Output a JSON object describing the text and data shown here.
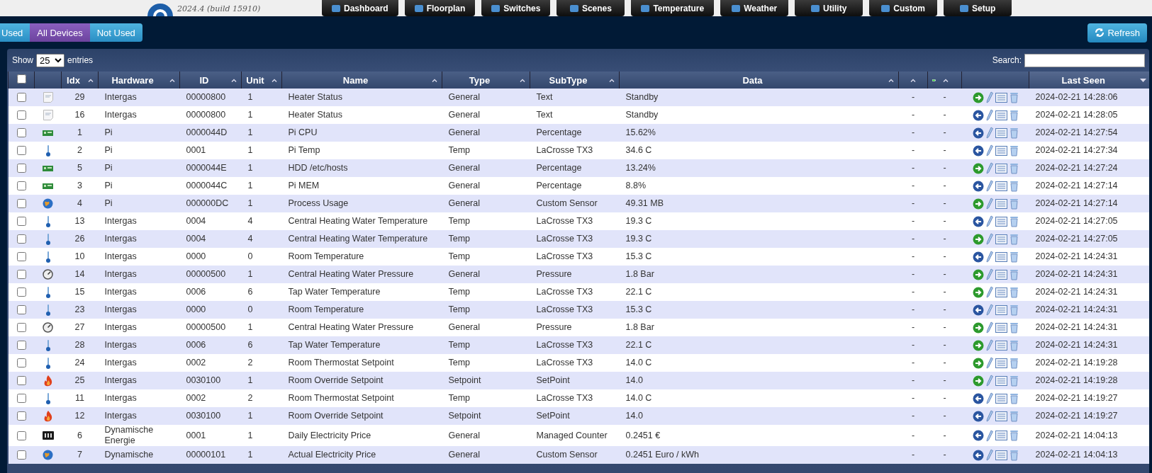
{
  "header": {
    "version": "2024.4 (build 15910)",
    "nav": [
      "Dashboard",
      "Floorplan",
      "Switches",
      "Scenes",
      "Temperature",
      "Weather",
      "Utility",
      "Custom",
      "Setup"
    ]
  },
  "filters": [
    {
      "label": "Used",
      "selected": false
    },
    {
      "label": "All Devices",
      "selected": true
    },
    {
      "label": "Not Used",
      "selected": false
    }
  ],
  "refresh_button": "Refresh",
  "table": {
    "show_label": "Show",
    "page_size": "25",
    "entries_label": "entries",
    "search_label": "Search:",
    "select_all_checked": false,
    "columns": [
      {
        "kind": "icon"
      },
      {
        "kind": "text",
        "label": "Idx",
        "sorted": false
      },
      {
        "kind": "text",
        "label": "Hardware",
        "sorted": false
      },
      {
        "kind": "text",
        "label": "ID",
        "sorted": false
      },
      {
        "kind": "text",
        "label": "Unit",
        "sorted": false
      },
      {
        "kind": "text",
        "label": "Name",
        "sorted": false
      },
      {
        "kind": "text",
        "label": "Type",
        "sorted": false
      },
      {
        "kind": "text",
        "label": "SubType",
        "sorted": false
      },
      {
        "kind": "text",
        "label": "Data",
        "sorted": false
      },
      {
        "kind": "signal",
        "sorted": false
      },
      {
        "kind": "battery",
        "sorted": false
      },
      {
        "kind": "actions"
      },
      {
        "kind": "text",
        "label": "Last Seen",
        "sorted": true
      }
    ],
    "rows": [
      {
        "checked": false,
        "kind": "text",
        "idx": "29",
        "hardware": "Intergas",
        "id": "00000800",
        "unit": "1",
        "name": "Heater Status",
        "type": "General",
        "subtype": "Text",
        "data": "Standby",
        "signal": "-",
        "battery": "-",
        "used": false,
        "last_seen": "2024-02-21 14:28:06"
      },
      {
        "checked": false,
        "kind": "text",
        "idx": "16",
        "hardware": "Intergas",
        "id": "00000800",
        "unit": "1",
        "name": "Heater Status",
        "type": "General",
        "subtype": "Text",
        "data": "Standby",
        "signal": "-",
        "battery": "-",
        "used": true,
        "last_seen": "2024-02-21 14:28:05"
      },
      {
        "checked": false,
        "kind": "board",
        "idx": "1",
        "hardware": "Pi",
        "id": "0000044D",
        "unit": "1",
        "name": "Pi CPU",
        "type": "General",
        "subtype": "Percentage",
        "data": "15.62%",
        "signal": "-",
        "battery": "-",
        "used": true,
        "last_seen": "2024-02-21 14:27:54"
      },
      {
        "checked": false,
        "kind": "thermometer",
        "idx": "2",
        "hardware": "Pi",
        "id": "0001",
        "unit": "1",
        "name": "Pi Temp",
        "type": "Temp",
        "subtype": "LaCrosse TX3",
        "data": "34.6 C",
        "signal": "-",
        "battery": "-",
        "used": true,
        "last_seen": "2024-02-21 14:27:34"
      },
      {
        "checked": false,
        "kind": "board",
        "idx": "5",
        "hardware": "Pi",
        "id": "0000044E",
        "unit": "1",
        "name": "HDD /etc/hosts",
        "type": "General",
        "subtype": "Percentage",
        "data": "13.24%",
        "signal": "-",
        "battery": "-",
        "used": false,
        "last_seen": "2024-02-21 14:27:24"
      },
      {
        "checked": false,
        "kind": "board",
        "idx": "3",
        "hardware": "Pi",
        "id": "0000044C",
        "unit": "1",
        "name": "Pi MEM",
        "type": "General",
        "subtype": "Percentage",
        "data": "8.8%",
        "signal": "-",
        "battery": "-",
        "used": true,
        "last_seen": "2024-02-21 14:27:14"
      },
      {
        "checked": false,
        "kind": "globe",
        "idx": "4",
        "hardware": "Pi",
        "id": "000000DC",
        "unit": "1",
        "name": "Process Usage",
        "type": "General",
        "subtype": "Custom Sensor",
        "data": "49.31 MB",
        "signal": "-",
        "battery": "-",
        "used": false,
        "last_seen": "2024-02-21 14:27:14"
      },
      {
        "checked": false,
        "kind": "thermometer",
        "idx": "13",
        "hardware": "Intergas",
        "id": "0004",
        "unit": "4",
        "name": "Central Heating Water Temperature",
        "type": "Temp",
        "subtype": "LaCrosse TX3",
        "data": "19.3 C",
        "signal": "-",
        "battery": "-",
        "used": true,
        "last_seen": "2024-02-21 14:27:05"
      },
      {
        "checked": false,
        "kind": "thermometer",
        "idx": "26",
        "hardware": "Intergas",
        "id": "0004",
        "unit": "4",
        "name": "Central Heating Water Temperature",
        "type": "Temp",
        "subtype": "LaCrosse TX3",
        "data": "19.3 C",
        "signal": "-",
        "battery": "-",
        "used": false,
        "last_seen": "2024-02-21 14:27:05"
      },
      {
        "checked": false,
        "kind": "thermometer",
        "idx": "10",
        "hardware": "Intergas",
        "id": "0000",
        "unit": "0",
        "name": "Room Temperature",
        "type": "Temp",
        "subtype": "LaCrosse TX3",
        "data": "15.3 C",
        "signal": "-",
        "battery": "-",
        "used": true,
        "last_seen": "2024-02-21 14:24:31"
      },
      {
        "checked": false,
        "kind": "gauge",
        "idx": "14",
        "hardware": "Intergas",
        "id": "00000500",
        "unit": "1",
        "name": "Central Heating Water Pressure",
        "type": "General",
        "subtype": "Pressure",
        "data": "1.8 Bar",
        "signal": "-",
        "battery": "-",
        "used": false,
        "last_seen": "2024-02-21 14:24:31"
      },
      {
        "checked": false,
        "kind": "thermometer",
        "idx": "15",
        "hardware": "Intergas",
        "id": "0006",
        "unit": "6",
        "name": "Tap Water Temperature",
        "type": "Temp",
        "subtype": "LaCrosse TX3",
        "data": "22.1 C",
        "signal": "-",
        "battery": "-",
        "used": false,
        "last_seen": "2024-02-21 14:24:31"
      },
      {
        "checked": false,
        "kind": "thermometer",
        "idx": "23",
        "hardware": "Intergas",
        "id": "0000",
        "unit": "0",
        "name": "Room Temperature",
        "type": "Temp",
        "subtype": "LaCrosse TX3",
        "data": "15.3 C",
        "signal": "-",
        "battery": "-",
        "used": true,
        "last_seen": "2024-02-21 14:24:31"
      },
      {
        "checked": false,
        "kind": "gauge",
        "idx": "27",
        "hardware": "Intergas",
        "id": "00000500",
        "unit": "1",
        "name": "Central Heating Water Pressure",
        "type": "General",
        "subtype": "Pressure",
        "data": "1.8 Bar",
        "signal": "-",
        "battery": "-",
        "used": false,
        "last_seen": "2024-02-21 14:24:31"
      },
      {
        "checked": false,
        "kind": "thermometer",
        "idx": "28",
        "hardware": "Intergas",
        "id": "0006",
        "unit": "6",
        "name": "Tap Water Temperature",
        "type": "Temp",
        "subtype": "LaCrosse TX3",
        "data": "22.1 C",
        "signal": "-",
        "battery": "-",
        "used": false,
        "last_seen": "2024-02-21 14:24:31"
      },
      {
        "checked": false,
        "kind": "thermometer",
        "idx": "24",
        "hardware": "Intergas",
        "id": "0002",
        "unit": "2",
        "name": "Room Thermostat Setpoint",
        "type": "Temp",
        "subtype": "LaCrosse TX3",
        "data": "14.0 C",
        "signal": "-",
        "battery": "-",
        "used": false,
        "last_seen": "2024-02-21 14:19:28"
      },
      {
        "checked": false,
        "kind": "flame",
        "idx": "25",
        "hardware": "Intergas",
        "id": "0030100",
        "unit": "1",
        "name": "Room Override Setpoint",
        "type": "Setpoint",
        "subtype": "SetPoint",
        "data": "14.0",
        "signal": "-",
        "battery": "-",
        "used": false,
        "last_seen": "2024-02-21 14:19:28"
      },
      {
        "checked": false,
        "kind": "thermometer",
        "idx": "11",
        "hardware": "Intergas",
        "id": "0002",
        "unit": "2",
        "name": "Room Thermostat Setpoint",
        "type": "Temp",
        "subtype": "LaCrosse TX3",
        "data": "14.0 C",
        "signal": "-",
        "battery": "-",
        "used": true,
        "last_seen": "2024-02-21 14:19:27"
      },
      {
        "checked": false,
        "kind": "flame",
        "idx": "12",
        "hardware": "Intergas",
        "id": "0030100",
        "unit": "1",
        "name": "Room Override Setpoint",
        "type": "Setpoint",
        "subtype": "SetPoint",
        "data": "14.0",
        "signal": "-",
        "battery": "-",
        "used": true,
        "last_seen": "2024-02-21 14:19:27"
      },
      {
        "checked": false,
        "kind": "counter",
        "idx": "6",
        "hardware": "Dynamische Energie",
        "id": "0001",
        "unit": "1",
        "name": "Daily Electricity Price",
        "type": "General",
        "subtype": "Managed Counter",
        "data": "0.2451 €",
        "signal": "-",
        "battery": "-",
        "used": true,
        "last_seen": "2024-02-21 14:04:13"
      },
      {
        "checked": false,
        "kind": "globe",
        "idx": "7",
        "hardware": "Dynamische",
        "id": "00000101",
        "unit": "1",
        "name": "Actual Electricity Price",
        "type": "General",
        "subtype": "Custom Sensor",
        "data": "0.2451 Euro / kWh",
        "signal": "-",
        "battery": "-",
        "used": true,
        "last_seen": "2024-02-21 14:04:13"
      }
    ]
  }
}
